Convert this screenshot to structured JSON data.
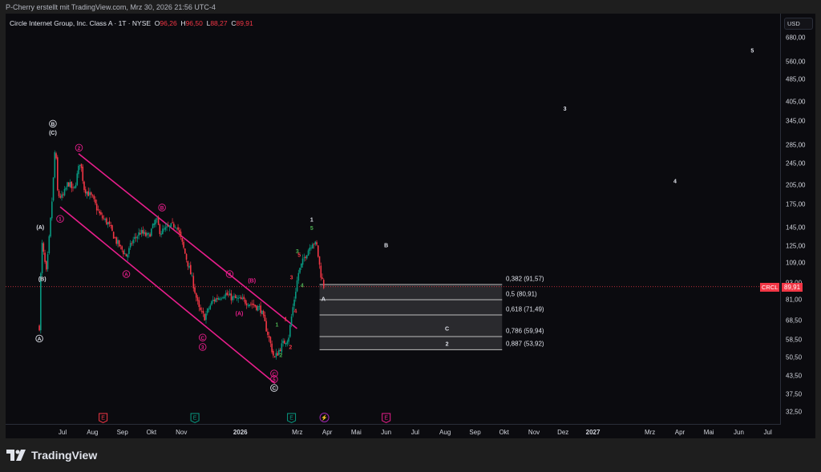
{
  "credit": "P-Cherry erstellt mit TradingView.com, Mrz 30, 2026 21:56 UTC-4",
  "legend": {
    "title": "Circle Internet Group, Inc. Class A · 1T · NYSE",
    "o_label": "O",
    "o": "96,26",
    "h_label": "H",
    "h": "96,50",
    "l_label": "L",
    "l": "88,27",
    "c_label": "C",
    "c": "89,91"
  },
  "currency": "USD",
  "last_price": {
    "symbol": "CRCL",
    "value": "89,91",
    "price": 89.91
  },
  "price_axis": [
    "680,00",
    "560,00",
    "485,00",
    "405,00",
    "345,00",
    "285,00",
    "245,00",
    "205,00",
    "175,00",
    "145,00",
    "125,00",
    "109,00",
    "93,00",
    "81,00",
    "68,50",
    "58,50",
    "50,50",
    "43,50",
    "37,50",
    "32,50"
  ],
  "time_axis": [
    {
      "label": "Jul",
      "t": 0
    },
    {
      "label": "Aug",
      "t": 31
    },
    {
      "label": "Sep",
      "t": 62
    },
    {
      "label": "Okt",
      "t": 92
    },
    {
      "label": "Nov",
      "t": 123
    },
    {
      "label": "2026",
      "t": 184,
      "bold": true
    },
    {
      "label": "Mrz",
      "t": 243
    },
    {
      "label": "Apr",
      "t": 274
    },
    {
      "label": "Mai",
      "t": 304
    },
    {
      "label": "Jun",
      "t": 335
    },
    {
      "label": "Jul",
      "t": 365
    },
    {
      "label": "Aug",
      "t": 396
    },
    {
      "label": "Sep",
      "t": 427
    },
    {
      "label": "Okt",
      "t": 457
    },
    {
      "label": "Nov",
      "t": 488
    },
    {
      "label": "Dez",
      "t": 518
    },
    {
      "label": "2027",
      "t": 549,
      "bold": true
    },
    {
      "label": "Mrz",
      "t": 608
    },
    {
      "label": "Apr",
      "t": 639
    },
    {
      "label": "Mai",
      "t": 669
    },
    {
      "label": "Jun",
      "t": 700
    },
    {
      "label": "Jul",
      "t": 730
    }
  ],
  "colors": {
    "up": "#089981",
    "down": "#f23645",
    "channel": "#e91e8c",
    "wave_pink": "#e91e8c",
    "wave_green": "#4caf50",
    "wave_red": "#f23645",
    "white": "#e0e3eb"
  },
  "chart_data": {
    "type": "candlestick",
    "title": "Circle Internet Group, Inc. Class A · 1T · NYSE",
    "scale": "log",
    "ylim": [
      30,
      720
    ],
    "x_unit": "days since 2025-07-01",
    "path": [
      [
        -24,
        65
      ],
      [
        -21.6,
        130
      ],
      [
        -16.6,
        100
      ],
      [
        -13.3,
        140
      ],
      [
        -10,
        200
      ],
      [
        -7.5,
        290
      ],
      [
        -5,
        190
      ],
      [
        0,
        185
      ],
      [
        5.8,
        210
      ],
      [
        11.6,
        195
      ],
      [
        18.3,
        250
      ],
      [
        22.4,
        200
      ],
      [
        30.7,
        185
      ],
      [
        39,
        160
      ],
      [
        47.3,
        150
      ],
      [
        55.6,
        130
      ],
      [
        66.4,
        115
      ],
      [
        72.2,
        130
      ],
      [
        80.5,
        140
      ],
      [
        88.8,
        135
      ],
      [
        97.1,
        155
      ],
      [
        101.2,
        140
      ],
      [
        109.5,
        145
      ],
      [
        117.8,
        150
      ],
      [
        126.1,
        120
      ],
      [
        134.4,
        95
      ],
      [
        141.1,
        75
      ],
      [
        146.9,
        70
      ],
      [
        155.2,
        80
      ],
      [
        167.6,
        85
      ],
      [
        176,
        82
      ],
      [
        188.4,
        80
      ],
      [
        196.7,
        78
      ],
      [
        205,
        75
      ],
      [
        213.3,
        60
      ],
      [
        219.1,
        50
      ],
      [
        225.7,
        55
      ],
      [
        234,
        60
      ],
      [
        238.2,
        75
      ],
      [
        244,
        100
      ],
      [
        250.6,
        115
      ],
      [
        258.9,
        130
      ],
      [
        263.1,
        125
      ],
      [
        267.2,
        100
      ],
      [
        270.5,
        90
      ]
    ],
    "channel": {
      "upper": [
        [
          16.6,
          265
        ],
        [
          242.7,
          64
        ]
      ],
      "lower": [
        [
          -2.5,
          172
        ],
        [
          219.9,
          41
        ]
      ]
    },
    "fib_levels": [
      {
        "ratio": "0,382",
        "price": 91.57,
        "label": "0,382 (91,57)"
      },
      {
        "ratio": "0,5",
        "price": 80.91,
        "label": "0,5 (80,91)"
      },
      {
        "ratio": "0,618",
        "price": 71.49,
        "label": "0,618 (71,49)"
      },
      {
        "ratio": "0,786",
        "price": 59.94,
        "label": "0,786 (59,94)"
      },
      {
        "ratio": "0,887",
        "price": 53.92,
        "label": "0,887 (53,92)"
      }
    ],
    "fib_range_t": [
      266,
      455
    ],
    "wave_labels": [
      {
        "text": "B",
        "t": -10,
        "p": 338,
        "c": "white",
        "circle": true
      },
      {
        "text": "(C)",
        "t": -10,
        "p": 315,
        "c": "white"
      },
      {
        "text": "(A)",
        "t": -23,
        "p": 146,
        "c": "white"
      },
      {
        "text": "(B)",
        "t": -21,
        "p": 96,
        "c": "white"
      },
      {
        "text": "A",
        "t": -24,
        "p": 59,
        "c": "white",
        "circle": true
      },
      {
        "text": "2",
        "t": 17,
        "p": 278,
        "c": "wave_pink",
        "circle": true
      },
      {
        "text": "1",
        "t": -2.5,
        "p": 156,
        "c": "wave_pink",
        "circle": true
      },
      {
        "text": "B",
        "t": 103,
        "p": 171,
        "c": "wave_pink",
        "circle": true
      },
      {
        "text": "A",
        "t": 66,
        "p": 99.6,
        "c": "wave_pink",
        "circle": true
      },
      {
        "text": "4",
        "t": 173,
        "p": 99.6,
        "c": "wave_pink",
        "circle": true
      },
      {
        "text": "(B)",
        "t": 196,
        "p": 94.5,
        "c": "wave_pink"
      },
      {
        "text": "(A)",
        "t": 183,
        "p": 72.4,
        "c": "wave_pink"
      },
      {
        "text": "C",
        "t": 145,
        "p": 59.5,
        "c": "wave_pink",
        "circle": true
      },
      {
        "text": "3",
        "t": 145,
        "p": 55.1,
        "c": "wave_pink",
        "circle": true
      },
      {
        "text": "C",
        "t": 219,
        "p": 44.4,
        "c": "wave_pink",
        "circle": true
      },
      {
        "text": "5",
        "t": 219,
        "p": 42.4,
        "c": "wave_pink",
        "circle": true
      },
      {
        "text": "C",
        "t": 219,
        "p": 39.5,
        "c": "white",
        "circle": true
      },
      {
        "text": "1",
        "t": 258,
        "p": 155,
        "c": "white"
      },
      {
        "text": "5",
        "t": 258,
        "p": 145,
        "c": "wave_green"
      },
      {
        "text": "B",
        "t": 335,
        "p": 126,
        "c": "white"
      },
      {
        "text": "3",
        "t": 520,
        "p": 383,
        "c": "white"
      },
      {
        "text": "4",
        "t": 634,
        "p": 212,
        "c": "white"
      },
      {
        "text": "5",
        "t": 714,
        "p": 613,
        "c": "white"
      },
      {
        "text": "A",
        "t": 270,
        "p": 81.5,
        "c": "white"
      },
      {
        "text": "C",
        "t": 398,
        "p": 64,
        "c": "white"
      },
      {
        "text": "2",
        "t": 398,
        "p": 56.6,
        "c": "white"
      },
      {
        "text": "3",
        "t": 243,
        "p": 120,
        "c": "wave_green"
      },
      {
        "text": "3",
        "t": 237,
        "p": 97,
        "c": "wave_red"
      },
      {
        "text": "4",
        "t": 241,
        "p": 74,
        "c": "wave_red"
      },
      {
        "text": "5",
        "t": 245,
        "p": 116.5,
        "c": "wave_red"
      },
      {
        "text": "4",
        "t": 248,
        "p": 91,
        "c": "wave_green"
      },
      {
        "text": "1",
        "t": 231,
        "p": 69.2,
        "c": "wave_red"
      },
      {
        "text": "1",
        "t": 222,
        "p": 66.1,
        "c": "wave_green"
      },
      {
        "text": "2",
        "t": 236,
        "p": 55.1,
        "c": "wave_red"
      },
      {
        "text": "2",
        "t": 226,
        "p": 51.6,
        "c": "wave_green"
      }
    ],
    "events": [
      {
        "type": "earnings",
        "label": "E",
        "t": 42,
        "color": "#f23645"
      },
      {
        "type": "earnings",
        "label": "E",
        "t": 137,
        "color": "#089981"
      },
      {
        "type": "earnings",
        "label": "E",
        "t": 237,
        "color": "#089981"
      },
      {
        "type": "dividend",
        "label": "⚡",
        "t": 271,
        "color": "#9c27b0"
      },
      {
        "type": "earnings",
        "label": "E",
        "t": 335,
        "color": "#e91e8c"
      }
    ]
  },
  "footer": {
    "brand": "TradingView"
  }
}
